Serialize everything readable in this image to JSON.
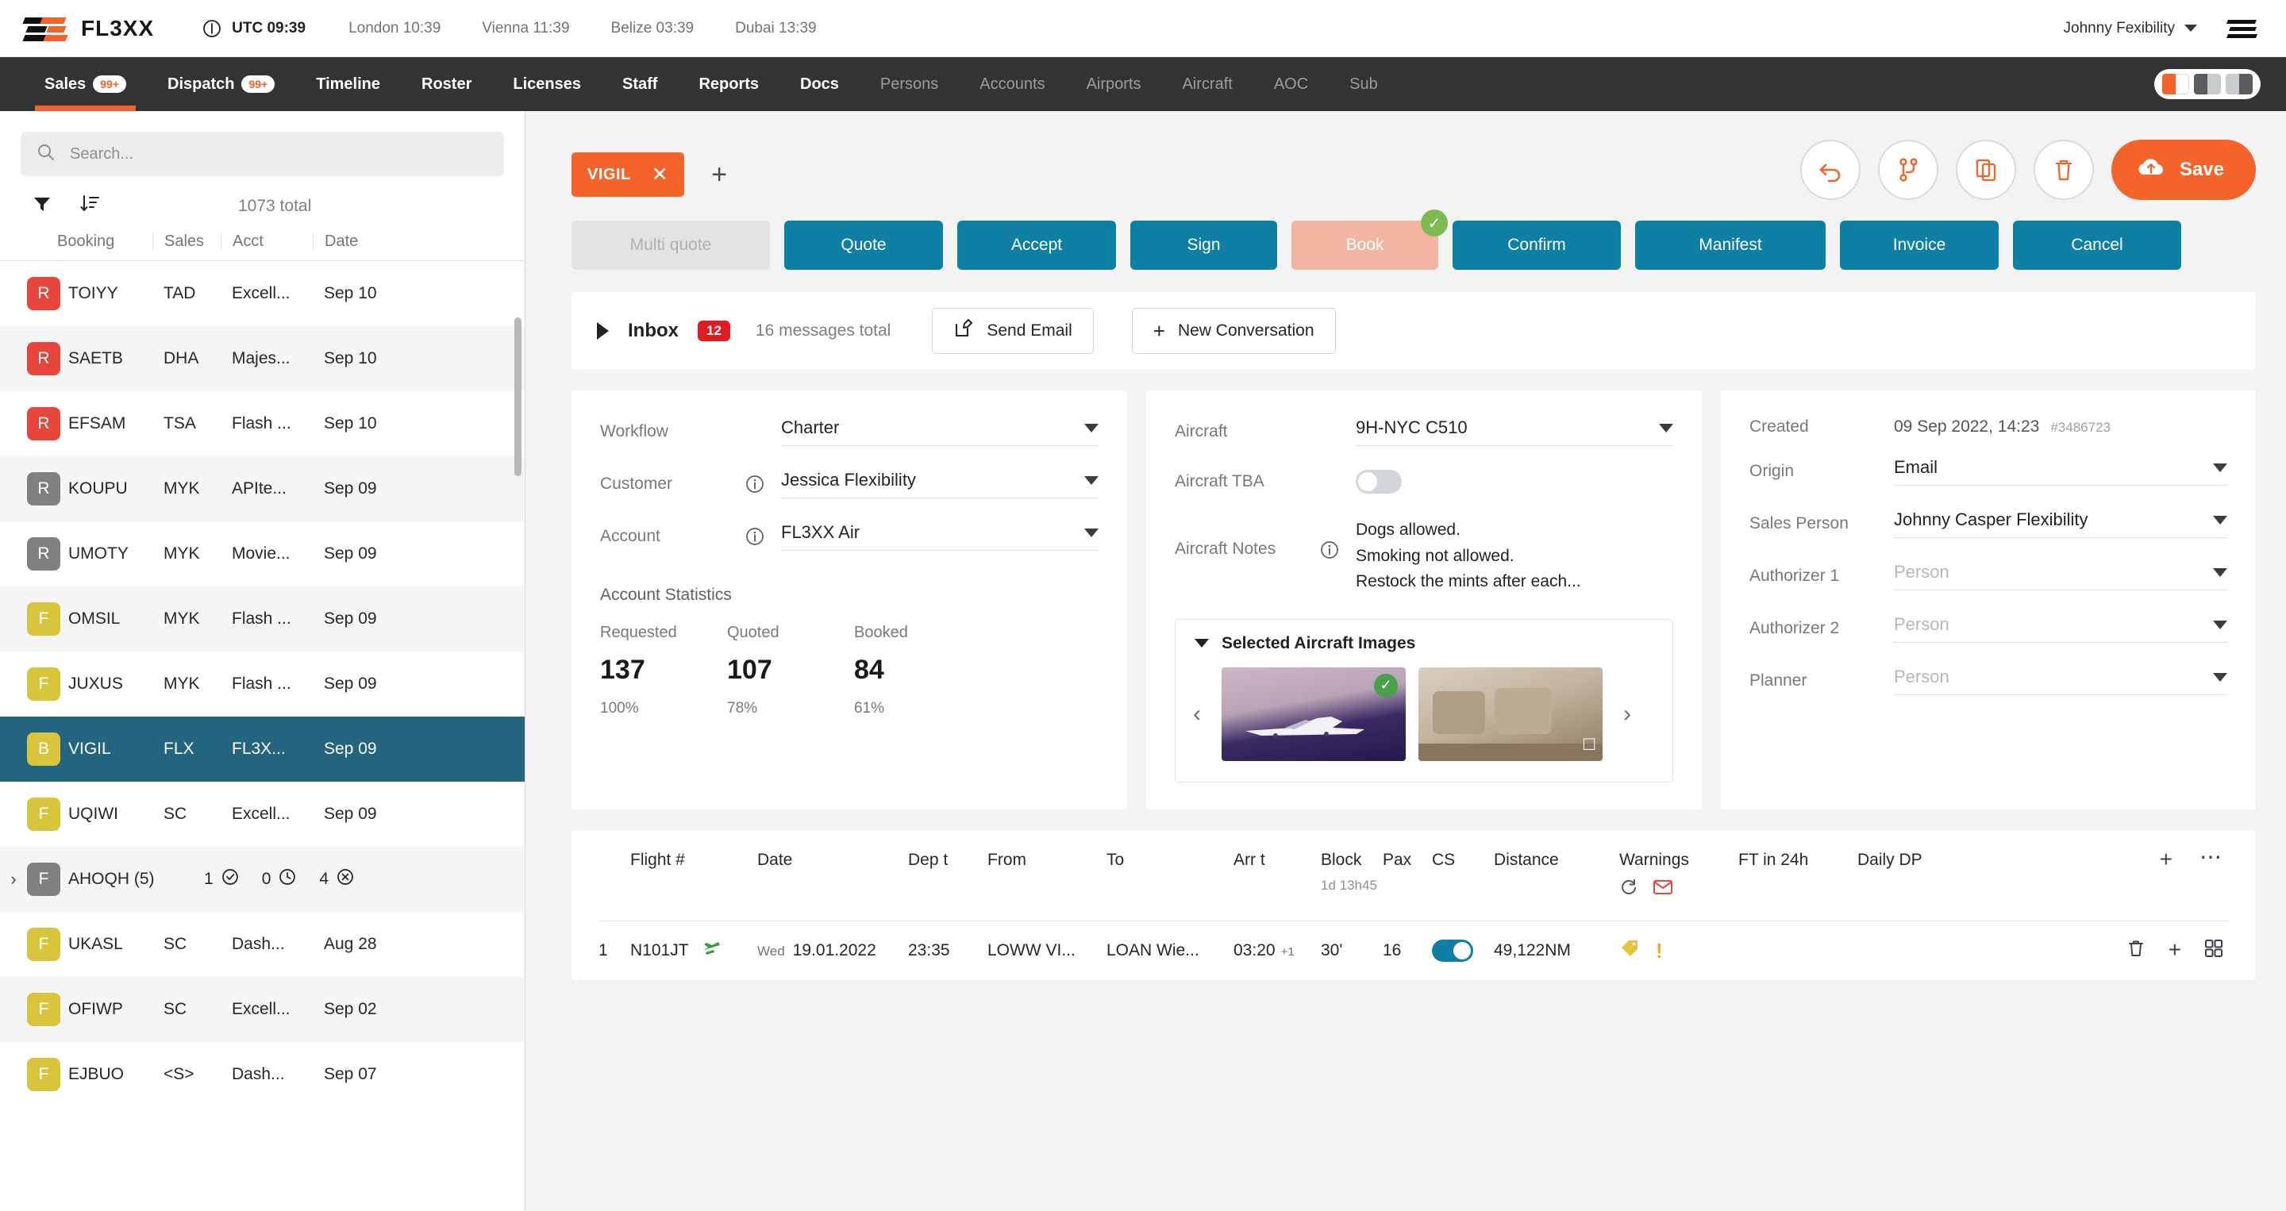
{
  "topbar": {
    "brand": "FL3XX",
    "utc_label": "UTC 09:39",
    "clocks": [
      {
        "label": "London 10:39"
      },
      {
        "label": "Vienna 11:39"
      },
      {
        "label": "Belize 03:39"
      },
      {
        "label": "Dubai 13:39"
      }
    ],
    "user": "Johnny Fexibility",
    "clock_icon": "clock-icon",
    "caret_icon": "chevron-down-icon",
    "menu_icon": "app-menu-icon"
  },
  "nav": {
    "items": [
      {
        "label": "Sales",
        "badge": "99+",
        "active": true,
        "style": "strong"
      },
      {
        "label": "Dispatch",
        "badge": "99+",
        "active": false,
        "style": "strong"
      },
      {
        "label": "Timeline",
        "badge": "",
        "active": false,
        "style": "strong"
      },
      {
        "label": "Roster",
        "badge": "",
        "active": false,
        "style": "strong"
      },
      {
        "label": "Licenses",
        "badge": "",
        "active": false,
        "style": "strong"
      },
      {
        "label": "Staff",
        "badge": "",
        "active": false,
        "style": "strong"
      },
      {
        "label": "Reports",
        "badge": "",
        "active": false,
        "style": "strong"
      },
      {
        "label": "Docs",
        "badge": "",
        "active": false,
        "style": "strong"
      },
      {
        "label": "Persons",
        "badge": "",
        "active": false,
        "style": "dim"
      },
      {
        "label": "Accounts",
        "badge": "",
        "active": false,
        "style": "dim"
      },
      {
        "label": "Airports",
        "badge": "",
        "active": false,
        "style": "dim"
      },
      {
        "label": "Aircraft",
        "badge": "",
        "active": false,
        "style": "dim"
      },
      {
        "label": "AOC",
        "badge": "",
        "active": false,
        "style": "dim"
      },
      {
        "label": "Sub",
        "badge": "",
        "active": false,
        "style": "dim"
      }
    ],
    "accent": "#f4642a",
    "bg": "#333333"
  },
  "sidebar": {
    "search_placeholder": "Search...",
    "search_icon": "search-icon",
    "filter_icon": "filter-icon",
    "sort_icon": "sort-descending-icon",
    "total": "1073 total",
    "columns": [
      "Booking",
      "Sales",
      "Acct",
      "Date"
    ],
    "rows": [
      {
        "badge": "R",
        "color": "b-red",
        "booking": "TOIYY",
        "sales": "TAD",
        "acct": "Excell...",
        "date": "Sep 10",
        "alt": false,
        "selected": false
      },
      {
        "badge": "R",
        "color": "b-red",
        "booking": "SAETB",
        "sales": "DHA",
        "acct": "Majes...",
        "date": "Sep 10",
        "alt": true,
        "selected": false
      },
      {
        "badge": "R",
        "color": "b-red",
        "booking": "EFSAM",
        "sales": "TSA",
        "acct": "Flash ...",
        "date": "Sep 10",
        "alt": false,
        "selected": false
      },
      {
        "badge": "R",
        "color": "b-gray",
        "booking": "KOUPU",
        "sales": "MYK",
        "acct": "APIte...",
        "date": "Sep 09",
        "alt": true,
        "selected": false
      },
      {
        "badge": "R",
        "color": "b-gray",
        "booking": "UMOTY",
        "sales": "MYK",
        "acct": "Movie...",
        "date": "Sep 09",
        "alt": false,
        "selected": false
      },
      {
        "badge": "F",
        "color": "b-yell",
        "booking": "OMSIL",
        "sales": "MYK",
        "acct": "Flash ...",
        "date": "Sep 09",
        "alt": true,
        "selected": false
      },
      {
        "badge": "F",
        "color": "b-yell",
        "booking": "JUXUS",
        "sales": "MYK",
        "acct": "Flash ...",
        "date": "Sep 09",
        "alt": false,
        "selected": false
      },
      {
        "badge": "B",
        "color": "b-yell",
        "booking": "VIGIL",
        "sales": "FLX",
        "acct": "FL3X...",
        "date": "Sep 09",
        "alt": false,
        "selected": true
      },
      {
        "badge": "F",
        "color": "b-yell",
        "booking": "UQIWI",
        "sales": "SC",
        "acct": "Excell...",
        "date": "Sep 09",
        "alt": false,
        "selected": false
      },
      {
        "badge": "F",
        "color": "b-gray",
        "booking": "AHOQH (5)",
        "sales": "",
        "acct": "",
        "date": "",
        "alt": true,
        "selected": false,
        "group": true,
        "counts": [
          {
            "n": "1",
            "icon": "check-circle-icon"
          },
          {
            "n": "0",
            "icon": "clock-circle-icon"
          },
          {
            "n": "4",
            "icon": "cancel-circle-icon"
          }
        ]
      },
      {
        "badge": "F",
        "color": "b-yell",
        "booking": "UKASL",
        "sales": "SC",
        "acct": "Dash...",
        "date": "Aug 28",
        "alt": false,
        "selected": false
      },
      {
        "badge": "F",
        "color": "b-yell",
        "booking": "OFIWP",
        "sales": "SC",
        "acct": "Excell...",
        "date": "Sep 02",
        "alt": true,
        "selected": false
      },
      {
        "badge": "F",
        "color": "b-yell",
        "booking": "EJBUO",
        "sales": "<S>",
        "acct": "Dash...",
        "date": "Sep 07",
        "alt": false,
        "selected": false
      }
    ]
  },
  "main": {
    "tab": {
      "label": "VIGIL",
      "close_icon": "close-icon"
    },
    "add_tab_icon": "plus-icon",
    "head_buttons": [
      {
        "name": "undo-button",
        "icon": "undo-arrow-icon"
      },
      {
        "name": "split-button",
        "icon": "branch-icon"
      },
      {
        "name": "duplicate-button",
        "icon": "copy-documents-icon"
      },
      {
        "name": "delete-button",
        "icon": "trash-icon"
      }
    ],
    "save_label": "Save",
    "save_icon": "cloud-upload-icon",
    "actions": [
      {
        "label": "Multi quote",
        "state": "disabled",
        "width": "w-mq"
      },
      {
        "label": "Quote",
        "state": "primary",
        "width": "w-quote"
      },
      {
        "label": "Accept",
        "state": "primary",
        "width": "w-accept"
      },
      {
        "label": "Sign",
        "state": "primary",
        "width": "w-sign"
      },
      {
        "label": "Book",
        "state": "pink",
        "width": "w-book",
        "check": true
      },
      {
        "label": "Confirm",
        "state": "primary",
        "width": "w-confirm"
      },
      {
        "label": "Manifest",
        "state": "primary",
        "width": "w-manifest"
      },
      {
        "label": "Invoice",
        "state": "primary",
        "width": "w-invoice"
      },
      {
        "label": "Cancel",
        "state": "primary",
        "width": "w-cancel"
      }
    ],
    "inbox": {
      "title": "Inbox",
      "badge": "12",
      "subtitle": "16 messages total",
      "send_email": "Send Email",
      "send_email_icon": "compose-icon",
      "new_conversation": "New Conversation",
      "new_conversation_icon": "plus-icon",
      "expand_icon": "triangle-right-icon"
    },
    "left_panel": {
      "fields": [
        {
          "label": "Workflow",
          "value": "Charter",
          "info": false
        },
        {
          "label": "Customer",
          "value": "Jessica Flexibility",
          "info": true
        },
        {
          "label": "Account",
          "value": "FL3XX Air",
          "info": true
        }
      ],
      "stats_title": "Account Statistics",
      "stats": [
        {
          "key": "Requested",
          "value": "137",
          "pct": "100%"
        },
        {
          "key": "Quoted",
          "value": "107",
          "pct": "78%"
        },
        {
          "key": "Booked",
          "value": "84",
          "pct": "61%"
        }
      ]
    },
    "mid_panel": {
      "aircraft_label": "Aircraft",
      "aircraft_value": "9H-NYC C510",
      "tba_label": "Aircraft TBA",
      "tba_on": false,
      "notes_label": "Aircraft Notes",
      "notes_info": true,
      "notes": "Dogs allowed.\nSmoking not allowed.\nRestock the mints after each...",
      "images_title": "Selected Aircraft Images",
      "prev_icon": "chevron-left-icon",
      "next_icon": "chevron-right-icon",
      "thumb1_check": "check-icon",
      "thumb2_icon": "expand-icon"
    },
    "right_panel": {
      "created_label": "Created",
      "created_value": "09 Sep 2022, 14:23",
      "created_id": "#3486723",
      "fields": [
        {
          "label": "Origin",
          "value": "Email",
          "placeholder": false
        },
        {
          "label": "Sales Person",
          "value": "Johnny Casper Flexibility",
          "placeholder": false
        },
        {
          "label": "Authorizer 1",
          "value": "Person",
          "placeholder": true
        },
        {
          "label": "Authorizer 2",
          "value": "Person",
          "placeholder": true
        },
        {
          "label": "Planner",
          "value": "Person",
          "placeholder": true
        }
      ]
    },
    "flights": {
      "columns": [
        "Flight #",
        "Date",
        "Dep t",
        "From",
        "To",
        "Arr t",
        "Block",
        "Pax",
        "CS",
        "Distance",
        "Warnings",
        "FT in 24h",
        "Daily DP"
      ],
      "block_note": "1d 13h45",
      "warning_icons": [
        "refresh-icon",
        "mail-warning-icon"
      ],
      "add_icon": "plus-icon",
      "more_icon": "ellipsis-icon",
      "rows": [
        {
          "num": "1",
          "flight": "N101JT",
          "plane_icon": "airplane-icon",
          "day": "Wed",
          "date": "19.01.2022",
          "dep": "23:35",
          "from": "LOWW VI...",
          "to": "LOAN Wie...",
          "arr": "03:20",
          "arr_sup": "+1",
          "block": "30'",
          "pax": "16",
          "cs_on": true,
          "distance": "49,122NM",
          "warn_icons": [
            "tag-icon",
            "exclamation-icon"
          ],
          "row_icons": [
            "trash-icon",
            "plus-icon",
            "grid-icon"
          ]
        }
      ]
    }
  }
}
